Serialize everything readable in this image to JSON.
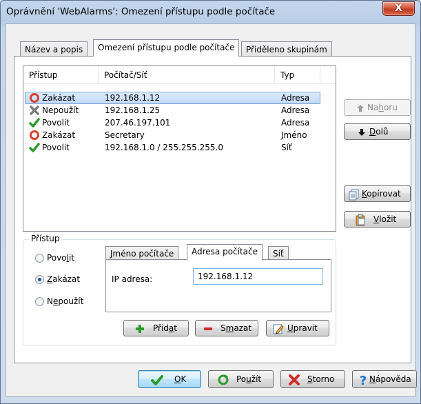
{
  "window": {
    "title": "Oprávnění 'WebAlarms': Omezení přístupu podle počítače",
    "close_glyph": "X"
  },
  "tabs": [
    {
      "label": "Název a popis"
    },
    {
      "label": "Omezení přístupu podle počítače"
    },
    {
      "label": "Přiděleno skupinám"
    }
  ],
  "list": {
    "columns": {
      "access": "Přístup",
      "computer": "Počítač/Síť",
      "type": "Typ"
    },
    "rows": [
      {
        "icon": "deny-icon",
        "access": "Zakázat",
        "computer": "192.168.1.12",
        "type": "Adresa",
        "selected": true
      },
      {
        "icon": "ignore-icon",
        "access": "Nepoužít",
        "computer": "192.168.1.25",
        "type": "Adresa",
        "selected": false
      },
      {
        "icon": "allow-icon",
        "access": "Povolit",
        "computer": "207.46.197.101",
        "type": "Adresa",
        "selected": false
      },
      {
        "icon": "deny-icon",
        "access": "Zakázat",
        "computer": "Secretary",
        "type": "Jméno",
        "selected": false
      },
      {
        "icon": "allow-icon",
        "access": "Povolit",
        "computer": "192.168.1.0 / 255.255.255.0",
        "type": "Síť",
        "selected": false
      }
    ]
  },
  "side_buttons": {
    "up": {
      "pre": "Na",
      "u": "h",
      "post": "oru"
    },
    "down": {
      "pre": "",
      "u": "D",
      "post": "olů"
    },
    "copy": {
      "pre": "",
      "u": "K",
      "post": "opírovat"
    },
    "paste": {
      "pre": "",
      "u": "V",
      "post": "ložit"
    }
  },
  "access_group": {
    "title": "Přístup",
    "options": [
      {
        "pre": "Povo",
        "u": "l",
        "post": "it",
        "checked": false
      },
      {
        "pre": "",
        "u": "Z",
        "post": "akázat",
        "checked": true
      },
      {
        "pre": "N",
        "u": "e",
        "post": "použít",
        "checked": false
      }
    ]
  },
  "inner_tabs": [
    {
      "label": "Jméno počítače"
    },
    {
      "label": "Adresa počítače"
    },
    {
      "label": "Síť"
    }
  ],
  "ip_field": {
    "label": "IP adresa:",
    "value": "192.168.1.12"
  },
  "action_buttons": {
    "add": {
      "pre": "Přid",
      "u": "a",
      "post": "t"
    },
    "delete": {
      "pre": "S",
      "u": "m",
      "post": "azat"
    },
    "edit": {
      "pre": "",
      "u": "U",
      "post": "pravit"
    }
  },
  "bottom_buttons": {
    "ok": {
      "pre": "",
      "u": "O",
      "post": "K"
    },
    "apply": {
      "pre": "Po",
      "u": "u",
      "post": "žít"
    },
    "cancel": {
      "pre": "",
      "u": "S",
      "post": "torno"
    },
    "help": {
      "pre": "",
      "u": "N",
      "post": "ápověda"
    }
  },
  "colors": {
    "allow": "#2e9a2e",
    "deny": "#d8402a",
    "ignore": "#7a7a7a",
    "add": "#2e9a2e",
    "delete": "#d22a2a",
    "help": "#1c74d0"
  }
}
